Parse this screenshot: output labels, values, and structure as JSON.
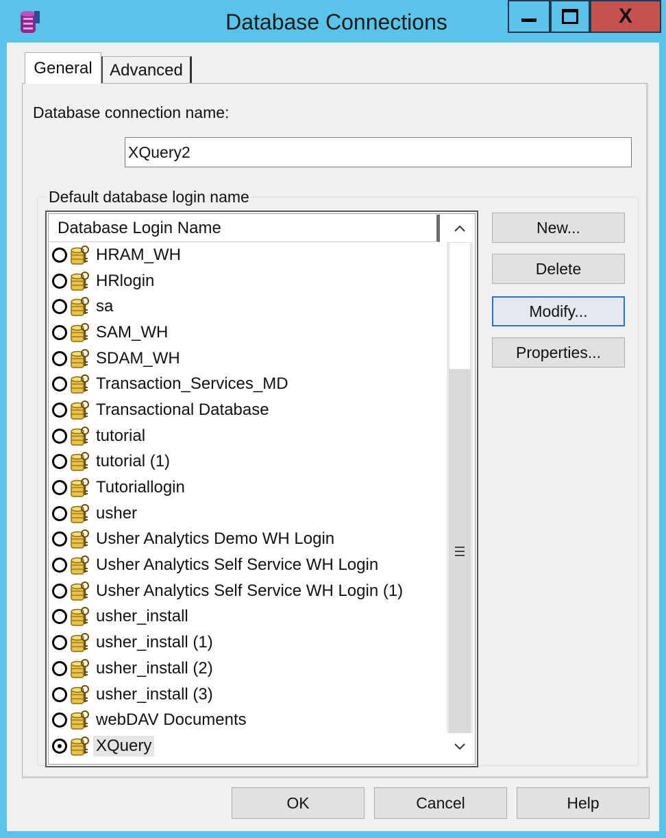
{
  "window": {
    "title": "Database Connections",
    "minimize_label": "▬",
    "maximize_label": "◻",
    "close_label": "X"
  },
  "tabs": [
    {
      "label": "General",
      "active": true
    },
    {
      "label": "Advanced",
      "active": false
    }
  ],
  "general": {
    "connection_name_label": "Database connection name:",
    "connection_name_value": "XQuery2",
    "group_label": "Default database login name",
    "column_header": "Database Login Name",
    "logins": [
      {
        "name": "HRAM_WH",
        "selected": false
      },
      {
        "name": "HRlogin",
        "selected": false
      },
      {
        "name": "sa",
        "selected": false
      },
      {
        "name": "SAM_WH",
        "selected": false
      },
      {
        "name": "SDAM_WH",
        "selected": false
      },
      {
        "name": "Transaction_Services_MD",
        "selected": false
      },
      {
        "name": "Transactional Database",
        "selected": false
      },
      {
        "name": "tutorial",
        "selected": false
      },
      {
        "name": "tutorial (1)",
        "selected": false
      },
      {
        "name": "Tutoriallogin",
        "selected": false
      },
      {
        "name": "usher",
        "selected": false
      },
      {
        "name": "Usher Analytics Demo WH Login",
        "selected": false
      },
      {
        "name": "Usher Analytics Self Service WH Login",
        "selected": false
      },
      {
        "name": "Usher Analytics Self Service WH Login (1)",
        "selected": false
      },
      {
        "name": "usher_install",
        "selected": false
      },
      {
        "name": "usher_install (1)",
        "selected": false
      },
      {
        "name": "usher_install (2)",
        "selected": false
      },
      {
        "name": "usher_install (3)",
        "selected": false
      },
      {
        "name": "webDAV Documents",
        "selected": false
      },
      {
        "name": "XQuery",
        "selected": true
      }
    ],
    "buttons": {
      "new": "New...",
      "delete": "Delete",
      "modify": "Modify...",
      "properties": "Properties..."
    }
  },
  "footer": {
    "ok": "OK",
    "cancel": "Cancel",
    "help": "Help"
  },
  "colors": {
    "title_bar": "#5bc3e8",
    "close_button": "#c75050",
    "dialog_bg": "#f0f0f0",
    "focus_border": "#2b6fc7"
  },
  "icons": {
    "app": "database-app-icon",
    "login": "database-login-icon"
  }
}
